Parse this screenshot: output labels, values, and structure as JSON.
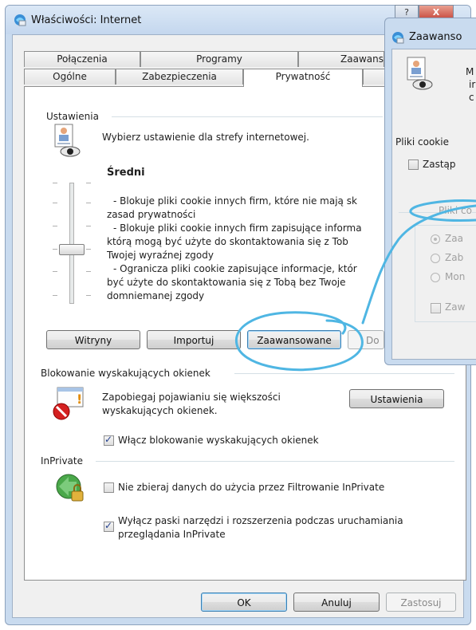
{
  "main_dialog": {
    "title": "Właściwości: Internet",
    "help_button": "?",
    "close_button": "X",
    "tabs_top": [
      "Połączenia",
      "Programy",
      "Zaawans"
    ],
    "tabs_bottom": [
      "Ogólne",
      "Zabezpieczenia",
      "Prywatność"
    ],
    "settings_group": "Ustawienia",
    "zone_instruction": "Wybierz ustawienie dla strefy internetowej.",
    "level_title": "Średni",
    "level_description": [
      "- Blokuje pliki cookie innych firm, które nie mają sk",
      "zasad prywatności",
      "- Blokuje pliki cookie innych firm zapisujące informa",
      "którą mogą być użyte do skontaktowania się z Tob",
      "Twojej wyraźnej zgody",
      "- Ogranicza pliki cookie zapisujące informacje, któr",
      "być użyte do skontaktowania się z Tobą bez Twoje",
      "domniemanej zgody"
    ],
    "buttons_row": {
      "sites": "Witryny",
      "import": "Importuj",
      "advanced": "Zaawansowane",
      "default": "Do"
    },
    "popup_group": "Blokowanie wyskakujących okienek",
    "popup_description": [
      "Zapobiegaj pojawianiu się większości",
      "wyskakujących okienek."
    ],
    "popup_settings_button": "Ustawienia",
    "popup_checkbox": "Włącz blokowanie wyskakujących okienek",
    "popup_checkbox_checked": true,
    "inprivate_group": "InPrivate",
    "inprivate_filter_checkbox": "Nie zbieraj danych do użycia przez Filtrowanie InPrivate",
    "inprivate_filter_checked": false,
    "inprivate_toolbars_checkbox": [
      "Wyłącz paski narzędzi i rozszerzenia podczas uruchamiania",
      "przeglądania InPrivate"
    ],
    "inprivate_toolbars_checked": true,
    "footer": {
      "ok": "OK",
      "cancel": "Anuluj",
      "apply": "Zastosuj"
    }
  },
  "advanced_dialog": {
    "title": "Zaawanso",
    "info_lines": [
      "M",
      "ir",
      "c"
    ],
    "cookies_label": "Pliki cookie",
    "override_checkbox": "Zastąp",
    "override_checked": false,
    "first_party_label": "Pliki co",
    "radio_accept": "Zaa",
    "radio_block": "Zab",
    "radio_prompt": "Mon",
    "session_checkbox": "Zaw"
  },
  "colors": {
    "annotation_stroke": "#4fb6e3",
    "window_frame": "#c9dbef"
  }
}
